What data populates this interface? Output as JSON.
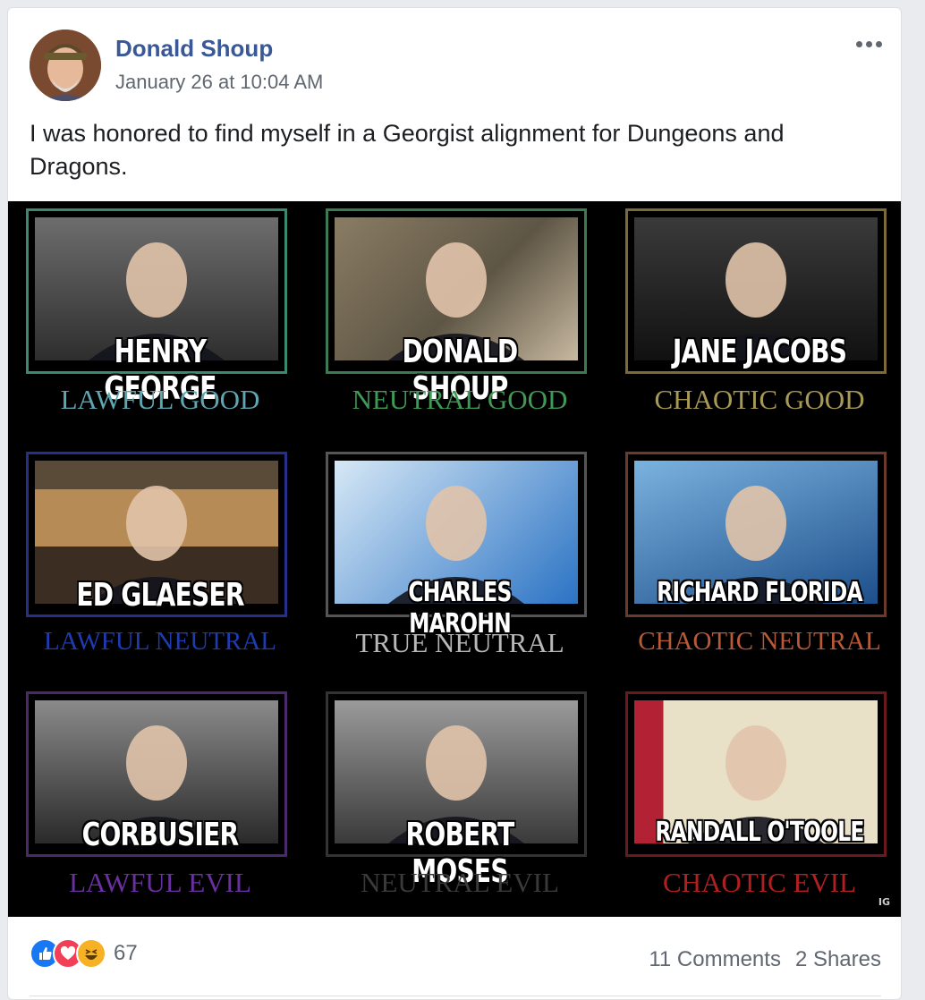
{
  "post": {
    "author": "Donald Shoup",
    "timestamp": "January 26 at 10:04 AM",
    "text": "I was honored to find myself in a Georgist alignment for Dungeons and Dragons.",
    "more_icon": "more-horizontal-icon"
  },
  "meme": {
    "watermark": "IG",
    "cells": [
      {
        "name": "HENRY GEORGE",
        "alignment": "LAWFUL GOOD",
        "color": "#5fa6b3"
      },
      {
        "name": "DONALD SHOUP",
        "alignment": "NEUTRAL GOOD",
        "color": "#3f9a55"
      },
      {
        "name": "JANE JACOBS",
        "alignment": "CHAOTIC GOOD",
        "color": "#a89a55"
      },
      {
        "name": "ED GLAESER",
        "alignment": "LAWFUL NEUTRAL",
        "color": "#1f3bb0"
      },
      {
        "name": "CHARLES MAROHN",
        "alignment": "TRUE NEUTRAL",
        "color": "#b8b8b8"
      },
      {
        "name": "RICHARD FLORIDA",
        "alignment": "CHAOTIC NEUTRAL",
        "color": "#b85a37"
      },
      {
        "name": "CORBUSIER",
        "alignment": "LAWFUL EVIL",
        "color": "#6a2fa0"
      },
      {
        "name": "ROBERT MOSES",
        "alignment": "NEUTRAL EVIL",
        "color": "#3a3a3a"
      },
      {
        "name": "RANDALL O'TOOLE",
        "alignment": "CHAOTIC EVIL",
        "color": "#b02020"
      }
    ]
  },
  "footer": {
    "reactions": [
      "like-icon",
      "love-icon",
      "haha-icon"
    ],
    "reaction_count": "67",
    "comments": "11 Comments",
    "shares": "2 Shares"
  },
  "colors": {
    "like": "#1877f2",
    "love": "#f33e58",
    "haha": "#f7b125",
    "link": "#385898"
  }
}
